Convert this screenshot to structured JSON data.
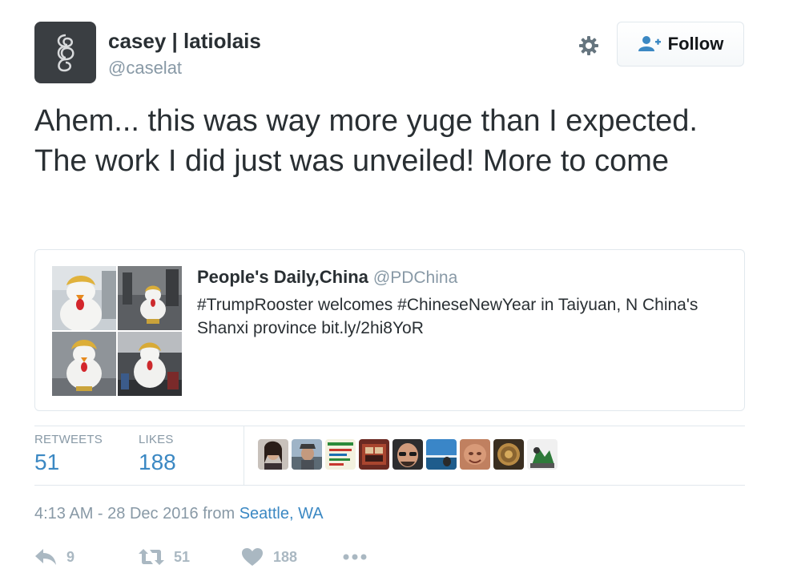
{
  "author": {
    "name": "casey | latiolais",
    "handle": "@caselat"
  },
  "header": {
    "follow_label": "Follow",
    "settings_icon": "gear-icon",
    "follow_icon": "person-plus-icon"
  },
  "tweet": {
    "text": "Ahem... this was way more yuge than I expected. The work I did just was unveiled! More to come"
  },
  "quoted": {
    "name": "People's Daily,China",
    "handle": "@PDChina",
    "text": "#TrumpRooster welcomes #ChineseNewYear in Taiyuan, N China's Shanxi province bit.ly/2hi8YoR",
    "media_count": 4
  },
  "stats": {
    "retweets_label": "RETWEETS",
    "retweets": "51",
    "likes_label": "LIKES",
    "likes": "188",
    "liker_avatar_count": 9
  },
  "meta": {
    "timestamp": "4:13 AM - 28 Dec 2016 from ",
    "location": "Seattle, WA"
  },
  "actions": {
    "reply_count": "9",
    "retweet_count": "51",
    "like_count": "188"
  },
  "colors": {
    "link": "#3b88c3",
    "muted": "#8899a6",
    "action": "#aab8c2",
    "border": "#e1e8ed",
    "text": "#292f33"
  }
}
